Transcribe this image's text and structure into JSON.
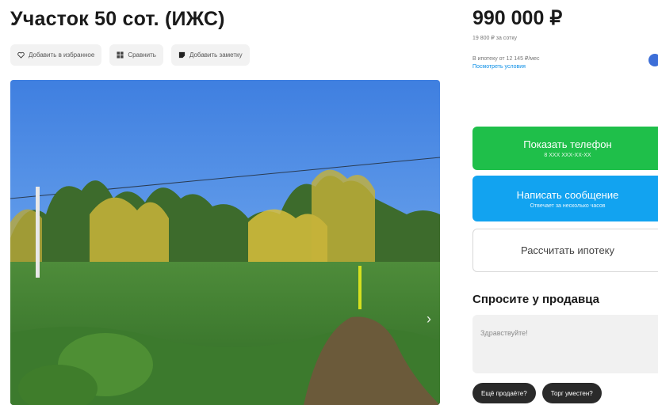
{
  "listing": {
    "title": "Участок 50 сот. (ИЖС)",
    "actions": [
      {
        "label": "Добавить в избранное",
        "icon": "heart-icon"
      },
      {
        "label": "Сравнить",
        "icon": "compare-icon"
      },
      {
        "label": "Добавить заметку",
        "icon": "note-icon"
      }
    ]
  },
  "pricing": {
    "price": "990 000 ₽",
    "per_unit": "19 800 ₽ за сотку",
    "mortgage_text": "В ипотеку от 12 145 ₽/мес",
    "mortgage_link": "Посмотреть условия"
  },
  "buttons": {
    "show_phone": "Показать телефон",
    "show_phone_sub": "8 XXX XXX-XX-XX",
    "write_message": "Написать сообщение",
    "write_message_sub": "Отвечает за несколько часов",
    "calc_mortgage": "Рассчитать ипотеку"
  },
  "ask": {
    "title": "Спросите у продавца",
    "placeholder": "Здравствуйте!",
    "chips": [
      "Ещё продаёте?",
      "Торг уместен?"
    ]
  },
  "colors": {
    "green": "#1fbf4a",
    "blue": "#12a3f0",
    "link": "#0a8ee6"
  }
}
